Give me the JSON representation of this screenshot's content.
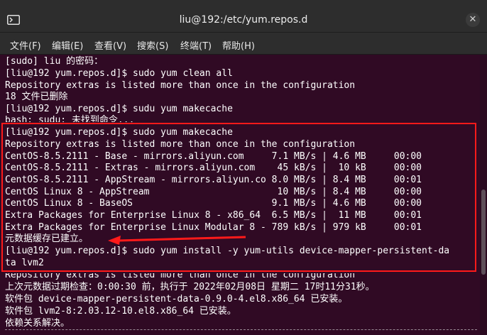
{
  "window": {
    "title": "liu@192:/etc/yum.repos.d",
    "close_glyph": "✕"
  },
  "menu": [
    "文件(F)",
    "编辑(E)",
    "查看(V)",
    "搜索(S)",
    "终端(T)",
    "帮助(H)"
  ],
  "terminal": {
    "lines": [
      "[sudo] liu 的密码：",
      "[liu@192 yum.repos.d]$ sudo yum clean all",
      "Repository extras is listed more than once in the configuration",
      "18 文件已删除",
      "[liu@192 yum.repos.d]$ sudu yum makecache",
      "bash: sudu: 未找到命令...",
      "[liu@192 yum.repos.d]$ sudo yum makecache",
      "Repository extras is listed more than once in the configuration",
      "CentOS-8.5.2111 - Base - mirrors.aliyun.com     7.1 MB/s | 4.6 MB     00:00",
      "CentOS-8.5.2111 - Extras - mirrors.aliyun.com    45 kB/s |  10 kB     00:00",
      "CentOS-8.5.2111 - AppStream - mirrors.aliyun.co 8.0 MB/s | 8.4 MB     00:01",
      "CentOS Linux 8 - AppStream                       10 MB/s | 8.4 MB     00:00",
      "CentOS Linux 8 - BaseOS                         9.1 MB/s | 4.6 MB     00:00",
      "Extra Packages for Enterprise Linux 8 - x86_64  6.5 MB/s |  11 MB     00:01",
      "Extra Packages for Enterprise Linux Modular 8 - 789 kB/s | 979 kB     00:01",
      "元数据缓存已建立。",
      "[liu@192 yum.repos.d]$ sudo yum install -y yum-utils device-mapper-persistent-da",
      "ta lvm2",
      "Repository extras is listed more than once in the configuration",
      "上次元数据过期检查：0:00:30 前，执行于 2022年02月08日 星期二 17时11分31秒。",
      "软件包 device-mapper-persistent-data-0.9.0-4.el8.x86_64 已安装。",
      "软件包 lvm2-8:2.03.12-10.el8.x86_64 已安装。",
      "依赖关系解决。"
    ]
  },
  "colors": {
    "terminal_bg": "#300a24",
    "highlight_box": "#ff1a1a",
    "text": "#ffffff"
  }
}
